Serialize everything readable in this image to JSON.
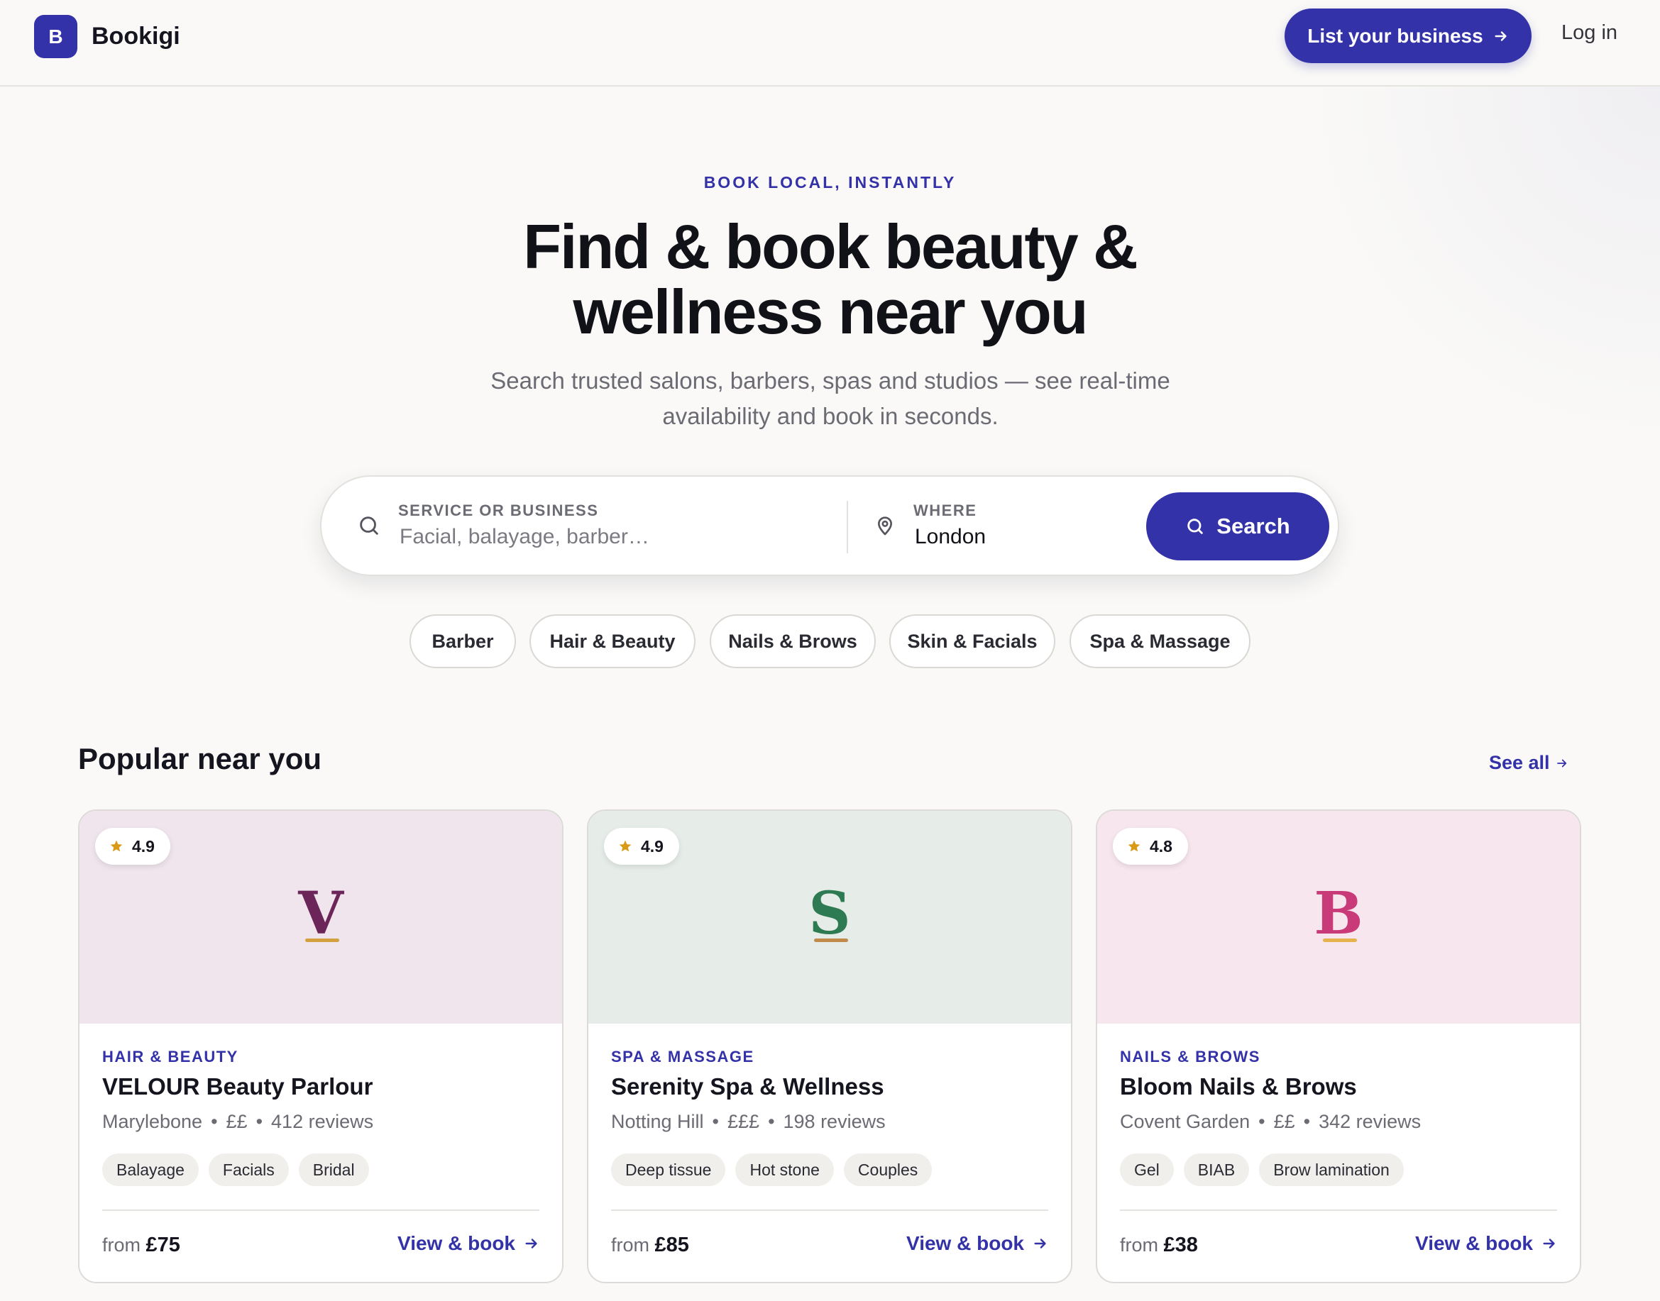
{
  "nav": {
    "brand_mark": "B",
    "brand_name": "Bookigi",
    "list_business": "List your business",
    "login": "Log in"
  },
  "hero": {
    "eyebrow": "BOOK LOCAL, INSTANTLY",
    "headline_line1": "Find & book beauty &",
    "headline_line2": "wellness near you",
    "subtitle": "Search trusted salons, barbers, spas and studios — see real-time availability and book in seconds."
  },
  "search": {
    "service_label": "SERVICE OR BUSINESS",
    "service_placeholder": "Facial, balayage, barber…",
    "where_label": "WHERE",
    "where_value": "London",
    "button_label": "Search"
  },
  "categories": [
    "Barber",
    "Hair & Beauty",
    "Nails & Brows",
    "Skin & Facials",
    "Spa & Massage"
  ],
  "popular": {
    "title": "Popular near you",
    "see_all": "See all",
    "cards": [
      {
        "rating": "4.9",
        "monogram": "V",
        "category": "HAIR & BEAUTY",
        "name": "VELOUR Beauty Parlour",
        "area": "Marylebone",
        "price_level": "££",
        "reviews": "412 reviews",
        "tags": [
          "Balayage",
          "Facials",
          "Bridal"
        ],
        "price_prefix": "from",
        "price": "£75",
        "cta": "View & book",
        "colors": {
          "hero": "#f0e5ed",
          "monogram": "#6b2558",
          "underline": "#d2a03e"
        }
      },
      {
        "rating": "4.9",
        "monogram": "S",
        "category": "SPA & MASSAGE",
        "name": "Serenity Spa & Wellness",
        "area": "Notting Hill",
        "price_level": "£££",
        "reviews": "198 reviews",
        "tags": [
          "Deep tissue",
          "Hot stone",
          "Couples"
        ],
        "price_prefix": "from",
        "price": "£85",
        "cta": "View & book",
        "colors": {
          "hero": "#e6ede9",
          "monogram": "#2e7a52",
          "underline": "#c08a4a"
        }
      },
      {
        "rating": "4.8",
        "monogram": "B",
        "category": "NAILS & BROWS",
        "name": "Bloom Nails & Brows",
        "area": "Covent Garden",
        "price_level": "££",
        "reviews": "342 reviews",
        "tags": [
          "Gel",
          "BIAB",
          "Brow lamination"
        ],
        "price_prefix": "from",
        "price": "£38",
        "cta": "View & book",
        "colors": {
          "hero": "#f8e6ee",
          "monogram": "#c93b78",
          "underline": "#e6b24c"
        }
      }
    ]
  },
  "colors": {
    "accent": "#3432a8",
    "background": "#faf9f7",
    "star": "#d99a18"
  },
  "icons": [
    "search-icon",
    "location-pin-icon",
    "arrow-right-icon",
    "star-icon"
  ]
}
